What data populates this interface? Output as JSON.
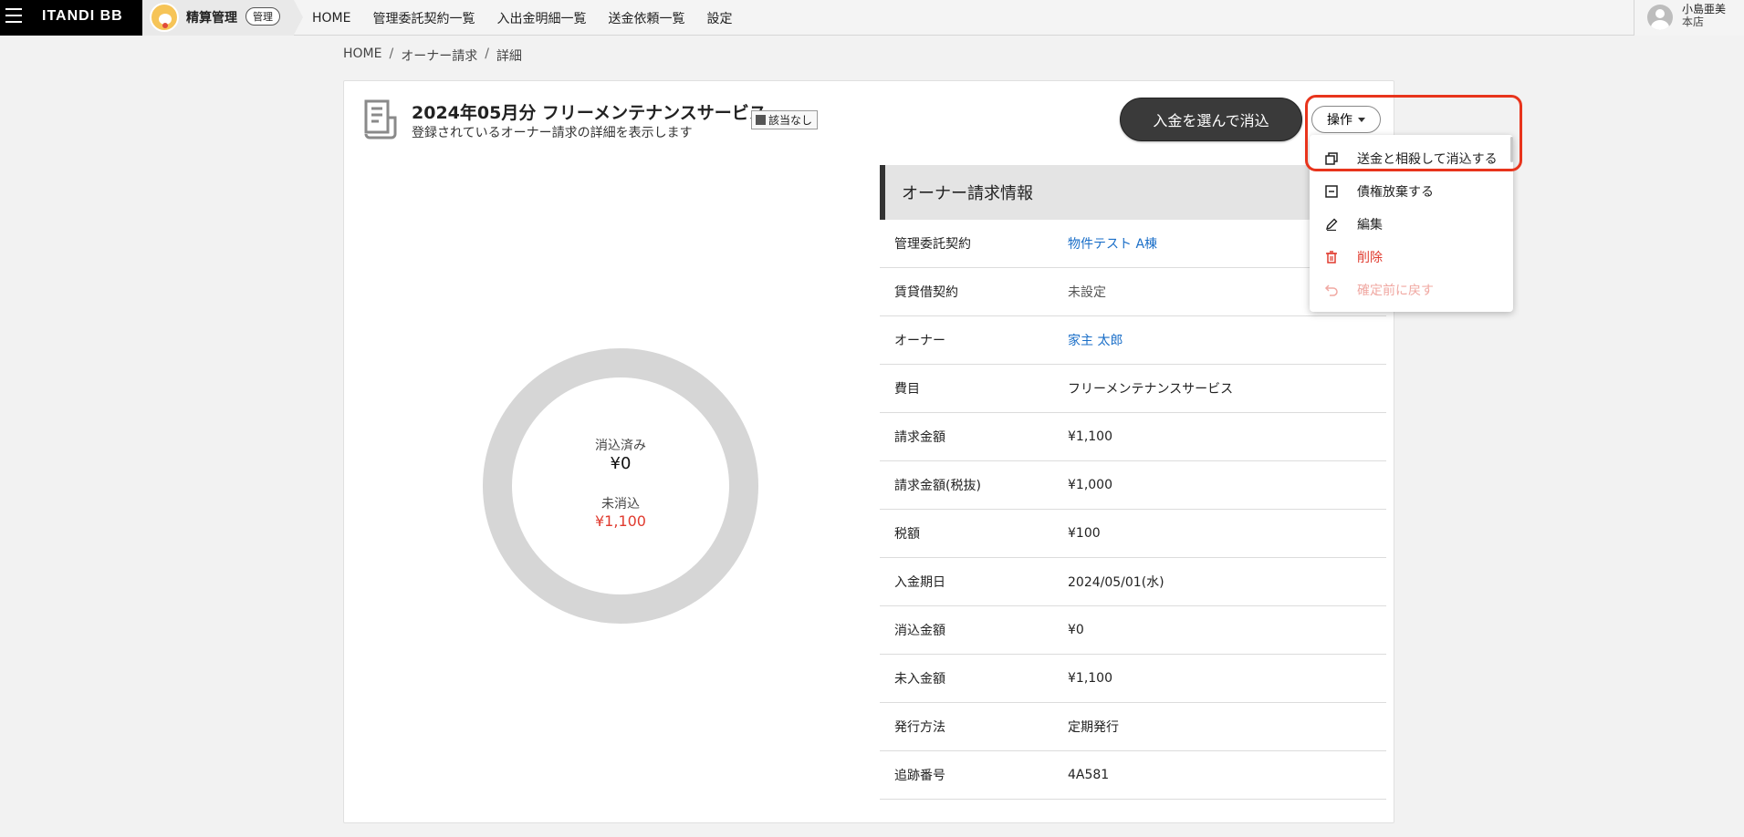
{
  "header": {
    "brand": "ITANDI BB",
    "app_name": "精算管理",
    "app_badge": "管理",
    "nav": [
      "HOME",
      "管理委託契約一覧",
      "入出金明細一覧",
      "送金依頼一覧",
      "設定"
    ],
    "user_name": "小島亜美",
    "user_branch": "本店"
  },
  "breadcrumb": [
    "HOME",
    "オーナー請求",
    "詳細"
  ],
  "page": {
    "title": "2024年05月分 フリーメンテナンスサービス",
    "subtitle": "登録されているオーナー請求の詳細を表示します",
    "tag": "該当なし",
    "primary_button": "入金を選んで消込",
    "operation_button": "操作"
  },
  "donut": {
    "cleared_label": "消込済み",
    "cleared_value": "¥0",
    "uncleared_label": "未消込",
    "uncleared_value": "¥1,100",
    "cleared_fraction": 0
  },
  "info": {
    "heading": "オーナー請求情報",
    "rows": [
      {
        "key": "管理委託契約",
        "value": "物件テスト A棟",
        "style": "link"
      },
      {
        "key": "賃貸借契約",
        "value": "未設定",
        "style": "muted"
      },
      {
        "key": "オーナー",
        "value": "家主 太郎",
        "style": "link"
      },
      {
        "key": "費目",
        "value": "フリーメンテナンスサービス",
        "style": ""
      },
      {
        "key": "請求金額",
        "value": "¥1,100",
        "style": ""
      },
      {
        "key": "請求金額(税抜)",
        "value": "¥1,000",
        "style": ""
      },
      {
        "key": "税額",
        "value": "¥100",
        "style": ""
      },
      {
        "key": "入金期日",
        "value": "2024/05/01(水)",
        "style": ""
      },
      {
        "key": "消込金額",
        "value": "¥0",
        "style": ""
      },
      {
        "key": "未入金額",
        "value": "¥1,100",
        "style": ""
      },
      {
        "key": "発行方法",
        "value": "定期発行",
        "style": ""
      },
      {
        "key": "追跡番号",
        "value": "4A581",
        "style": ""
      }
    ]
  },
  "menu": {
    "items": [
      {
        "label": "送金と相殺して消込する",
        "icon": "copy-icon",
        "state": "normal"
      },
      {
        "label": "債権放棄する",
        "icon": "minus-square-icon",
        "state": "normal"
      },
      {
        "label": "編集",
        "icon": "pencil-icon",
        "state": "normal"
      },
      {
        "label": "削除",
        "icon": "trash-icon",
        "state": "danger"
      },
      {
        "label": "確定前に戻す",
        "icon": "undo-icon",
        "state": "disabled"
      }
    ]
  },
  "colors": {
    "link": "#1b6fc8",
    "danger": "#e03b2f",
    "highlight": "#e8341c",
    "donut_track": "#d6d6d6"
  }
}
